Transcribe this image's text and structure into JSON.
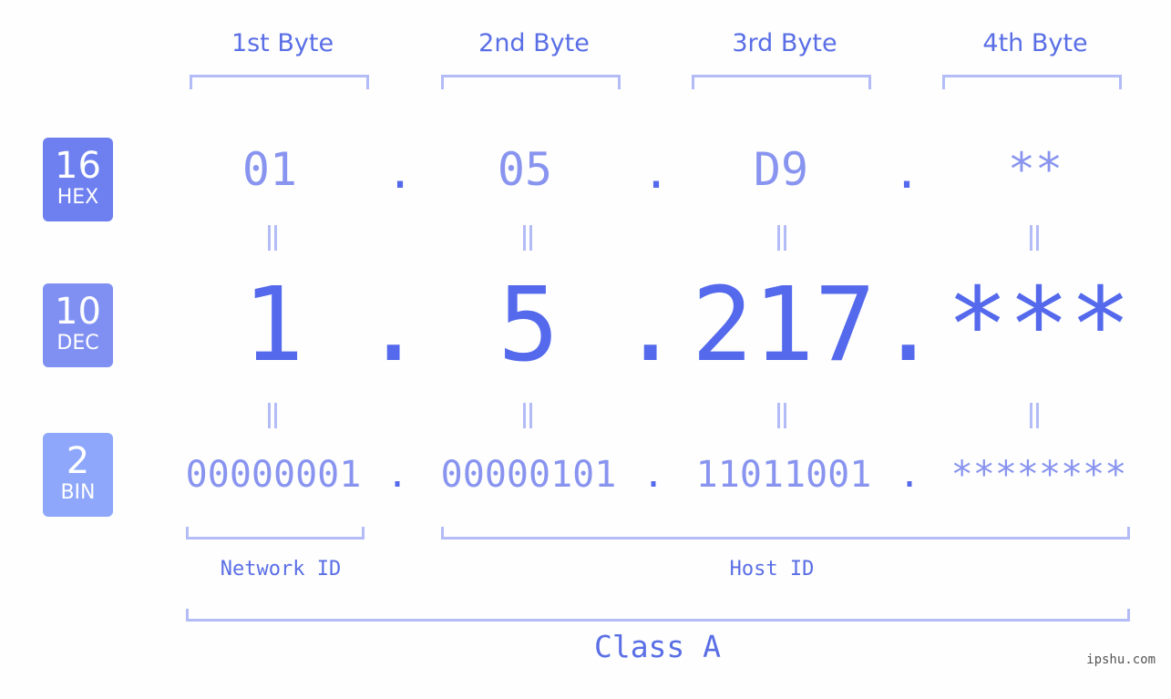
{
  "badges": [
    {
      "num": "16",
      "label": "HEX",
      "color": "#6e7ff0"
    },
    {
      "num": "10",
      "label": "DEC",
      "color": "#8090f2"
    },
    {
      "num": "2",
      "label": "BIN",
      "color": "#8ea7fa"
    }
  ],
  "headers": [
    "1st Byte",
    "2nd Byte",
    "3rd Byte",
    "4th Byte"
  ],
  "hex": [
    "01",
    "05",
    "D9",
    "**"
  ],
  "dec": [
    "1",
    "5",
    "217",
    "***"
  ],
  "bin": [
    "00000001",
    "00000101",
    "11011001",
    "********"
  ],
  "separator": ".",
  "network_id_label": "Network ID",
  "host_id_label": "Host ID",
  "class_label": "Class A",
  "watermark": "ipshu.com",
  "colors": {
    "accent": "#5569ec",
    "light": "#8894ef",
    "bracket": "#b3bcf6"
  }
}
